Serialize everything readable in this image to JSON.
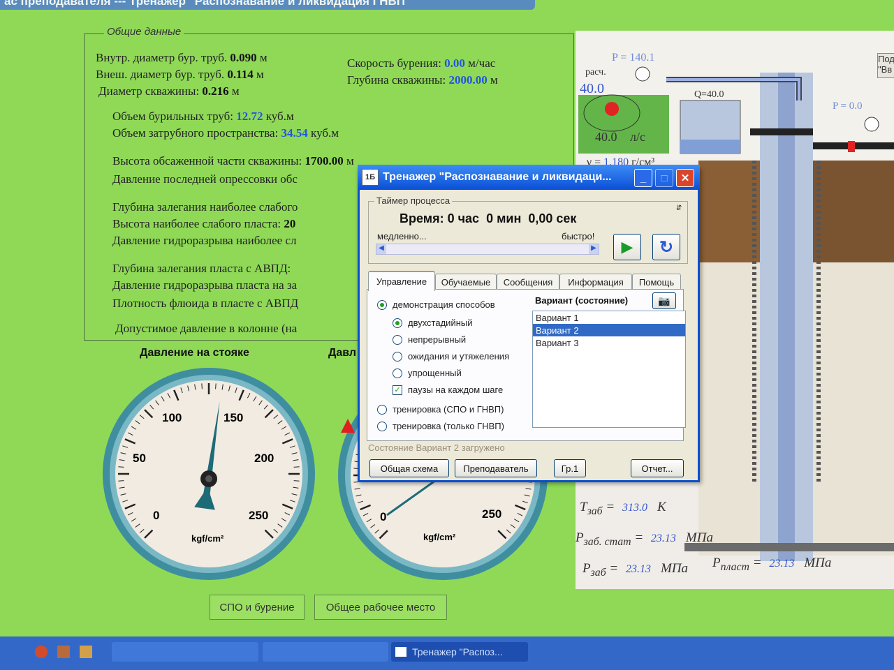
{
  "window_title": "ас преподавателя --- Тренажер \"Распознавание и ликвидация ГНВП\"",
  "general": {
    "group_title": "Общие данные",
    "inner_pipe_label": "Внутр. диаметр бур. труб.",
    "inner_pipe_value": "0.090",
    "inner_pipe_unit": "м",
    "outer_pipe_label": "Внеш. диаметр бур. труб.",
    "outer_pipe_value": "0.114",
    "outer_pipe_unit": "м",
    "well_diam_label": "Диаметр скважины:",
    "well_diam_value": "0.216",
    "well_diam_unit": "м",
    "drill_speed_label": "Скорость бурения:",
    "drill_speed_value": "0.00",
    "drill_speed_unit": "м/час",
    "well_depth_label": "Глубина скважины:",
    "well_depth_value": "2000.00",
    "well_depth_unit": "м",
    "pipe_volume_label": "Объем бурильных труб:",
    "pipe_volume_value": "12.72",
    "pipe_volume_unit": "куб.м",
    "annulus_volume_label": "Объем затрубного пространства:",
    "annulus_volume_value": "34.54",
    "annulus_volume_unit": "куб.м",
    "cased_height_label": "Высота обсаженной части скважины:",
    "cased_height_value": "1700.00",
    "cased_height_unit": "м",
    "last_test_label": "Давление последней опрессовки обс",
    "weak_depth_label": "Глубина залегания наиболее слабого",
    "weak_height_label": "Высота наиболее слабого пласта:",
    "weak_height_value": "20",
    "weak_frac_label": "Давление гидроразрыва наиболее сл",
    "avpd_depth_label": "Глубина залегания пласта с АВПД:",
    "avpd_frac_label": "Давление гидроразрыва пласта на за",
    "avpd_density_label": "Плотность флюида в пласте с АВПД",
    "allowed_pressure_label": "Допустимое давление в колонне (на"
  },
  "gauges": {
    "standpipe_label": "Давление на стояке",
    "second_label": "Давл",
    "unit": "kgf/cm²",
    "ticks_left": [
      "0",
      "50",
      "100",
      "150",
      "200",
      "250"
    ],
    "ticks_right": [
      "0",
      "250"
    ],
    "standpipe_reading": 150,
    "scale_max": 300
  },
  "scheme": {
    "p_top_left": "P = 140.1",
    "calc_label": "расч.",
    "calc_value": "40.0",
    "pump_value": "40.0",
    "pump_unit": "л/с",
    "q_label": "Q=40.0",
    "p_top_right": "P = 0.0",
    "gamma_label": "γ =",
    "gamma_value": "1.180",
    "gamma_unit": "г/см³",
    "side_button": "Пода \"Вв",
    "t_label": "T",
    "t_sub": "заб",
    "t_value": "313.0",
    "t_unit": "K",
    "p_stat_label": "P",
    "p_stat_sub": "заб. стат",
    "p_stat_value": "23.13",
    "p_stat_unit": "МПа",
    "p_zab_label": "P",
    "p_zab_sub": "заб",
    "p_zab_value": "23.13",
    "p_zab_unit": "МПа",
    "p_plast_label": "P",
    "p_plast_sub": "пласт",
    "p_plast_value": "23.13",
    "p_plast_unit": "МПа"
  },
  "bottom_buttons": {
    "spo": "СПО и бурение",
    "workplace": "Общее рабочее место"
  },
  "taskbar": {
    "item1": "Тренажер \"Распоз..."
  },
  "dialog": {
    "title": "Тренажер \"Распознавание и ликвидаци...",
    "timer_group": "Таймер процесса",
    "time_text": "Время: 0 час  0 мин  0,00 сек",
    "slow": "медленно...",
    "fast": "быстро!",
    "tabs": [
      "Управление",
      "Обучаемые",
      "Сообщения",
      "Информация",
      "Помощь"
    ],
    "demo": "демонстрация способов",
    "methods": [
      "двухстадийный",
      "непрерывный",
      "ожидания и утяжеления",
      "упрощенный"
    ],
    "pauses": "паузы на каждом шаге",
    "training1": "тренировка (СПО и ГНВП)",
    "training2": "тренировка (только ГНВП)",
    "variant_header": "Вариант (состояние)",
    "variants": [
      "Вариант 1",
      "Вариант 2",
      "Вариант 3"
    ],
    "status": "Состояние Вариант 2 загружено",
    "buttons": {
      "scheme": "Общая схема",
      "teacher": "Преподаватель",
      "gr": "Гр.1",
      "report": "Отчет..."
    }
  }
}
